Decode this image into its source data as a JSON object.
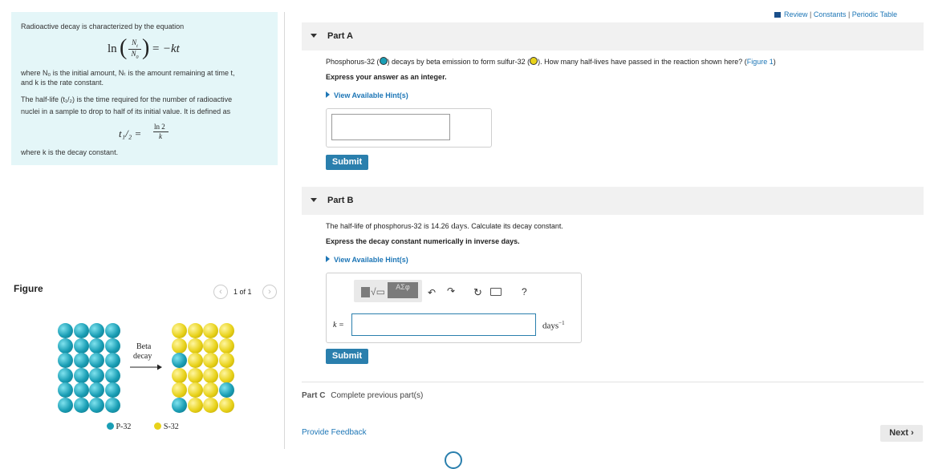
{
  "topbar": {
    "review": "Review",
    "sep1": "|",
    "constants": "Constants",
    "sep2": "|",
    "periodic": "Periodic Table"
  },
  "info": {
    "intro": "Radioactive decay is characterized by the equation",
    "eq1_ln": "ln",
    "eq1_num": "N",
    "eq1_num_sub": "t",
    "eq1_den": "N",
    "eq1_den_sub": "0",
    "eq1_rhs": "= −kt",
    "where1": "where N₀ is the initial amount, Nₜ is the amount remaining at time t,",
    "where1b": "and k is the rate constant.",
    "halflife1": "The half-life (t₁/₂) is the time required for the number of radioactive",
    "halflife2": "nuclei in a sample to drop to half of its initial value. It is defined as",
    "eq2_lhs": "t₁/₂ =",
    "eq2_num": "ln 2",
    "eq2_den": "k",
    "where2": "where k is the decay constant."
  },
  "figure": {
    "title": "Figure",
    "pager": "1 of 1",
    "arrow_label_1": "Beta",
    "arrow_label_2": "decay",
    "legend": [
      {
        "label": "P-32",
        "color": "#1a9eb5"
      },
      {
        "label": "S-32",
        "color": "#e8d21a"
      }
    ],
    "left_grid": [
      "B",
      "B",
      "B",
      "B",
      "B",
      "B",
      "B",
      "B",
      "B",
      "B",
      "B",
      "B",
      "B",
      "B",
      "B",
      "B",
      "B",
      "B",
      "B",
      "B",
      "B",
      "B",
      "B",
      "B"
    ],
    "right_grid": [
      "Y",
      "Y",
      "Y",
      "Y",
      "Y",
      "Y",
      "Y",
      "Y",
      "B",
      "Y",
      "Y",
      "Y",
      "Y",
      "Y",
      "Y",
      "Y",
      "Y",
      "Y",
      "Y",
      "B",
      "B",
      "Y",
      "Y",
      "Y"
    ]
  },
  "partA": {
    "title": "Part A",
    "question_pre": "Phosphorus-32 (",
    "question_mid": ") decays by beta emission to form sulfur-32 (",
    "question_post": "). How many half-lives have passed in the reaction shown here? (",
    "figure_link": "Figure 1",
    "question_end": ")",
    "instruction": "Express your answer as an integer.",
    "hints": "View Available Hint(s)",
    "answer_value": "",
    "submit": "Submit"
  },
  "partB": {
    "title": "Part B",
    "question_pre": "The half-life of phosphorus-32 is 14.26",
    "question_unit": "days",
    "question_post": ". Calculate its decay constant.",
    "instruction": "Express the decay constant numerically in inverse days.",
    "hints": "View Available Hint(s)",
    "toolbar_aepsilon": "AΣφ",
    "help": "?",
    "var_label": "k =",
    "answer_value": "",
    "unit": "days",
    "unit_exp": "−1",
    "submit": "Submit"
  },
  "partC": {
    "label": "Part C",
    "text": "Complete previous part(s)"
  },
  "footer": {
    "feedback": "Provide Feedback",
    "next": "Next"
  }
}
